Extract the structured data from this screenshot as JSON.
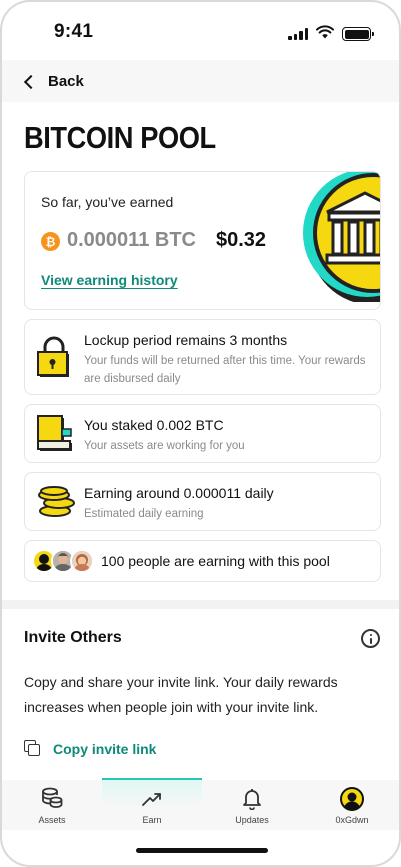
{
  "status_bar": {
    "time": "9:41"
  },
  "nav": {
    "back_label": "Back"
  },
  "page": {
    "title": "BITCOIN POOL"
  },
  "earnings": {
    "label": "So far, you’ve earned",
    "btc_symbol": "₿",
    "btc_amount": "0.000011 BTC",
    "usd_amount": "$0.32",
    "history_link": "View earning history",
    "icon": "bank-icon"
  },
  "info_cards": [
    {
      "icon": "lock-icon",
      "title": "Lockup period remains 3 months",
      "subtitle": "Your funds will be returned after this time. Your rewards are disbursed daily"
    },
    {
      "icon": "book-icon",
      "title": "You staked 0.002 BTC",
      "subtitle": "Your assets are working for you"
    },
    {
      "icon": "coins-icon",
      "title": "Earning around 0.000011 daily",
      "subtitle": "Estimated daily earning"
    }
  ],
  "participants": {
    "text": "100 people are earning with this pool"
  },
  "invite": {
    "title": "Invite Others",
    "description": "Copy and share your invite link. Your daily rewards increases when people join with your invite link.",
    "copy_label": "Copy invite link"
  },
  "tabs": [
    {
      "label": "Assets",
      "icon": "assets-icon",
      "active": false
    },
    {
      "label": "Earn",
      "icon": "earn-trend-icon",
      "active": true
    },
    {
      "label": "Updates",
      "icon": "bell-icon",
      "active": false
    },
    {
      "label": "0xGdwn",
      "icon": "avatar-icon",
      "active": false
    }
  ],
  "colors": {
    "accent": "#0e8a78",
    "tab_highlight": "#24c7b3",
    "brand_yellow": "#f5d80f",
    "bitcoin": "#f7931a"
  }
}
